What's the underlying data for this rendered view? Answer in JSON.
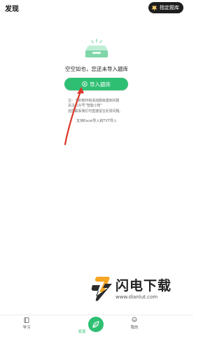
{
  "header": {
    "title": "发现",
    "pin_button_label": "指定题库"
  },
  "empty_state": {
    "message": "空空如也，您还未导入题库",
    "import_button_label": "导入题库",
    "note_lines": [
      "注：个别制作和添加题库遇到问题",
      "关注公众号“智能小智”",
      "选择联系我们可直接留言反馈问题。"
    ],
    "support_text": "支持Excel导入和TXT导入"
  },
  "watermark": {
    "title": "闪电下载",
    "url": "www.dianlut.com"
  },
  "tabbar": {
    "tabs": [
      {
        "label": "学习"
      },
      {
        "label": "发现"
      },
      {
        "label": "我的"
      }
    ]
  },
  "colors": {
    "accent": "#2fbf73",
    "annotation_arrow": "#d9372b",
    "pin_button_bg": "#1e1e1e"
  },
  "icons": {
    "pin": "pin-icon",
    "empty": "empty-tray-icon",
    "plus": "plus-circle-icon",
    "learn": "book-icon",
    "discover": "leaf-icon",
    "profile": "user-icon"
  }
}
